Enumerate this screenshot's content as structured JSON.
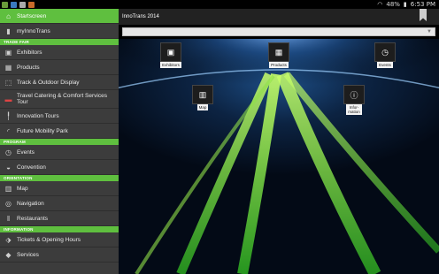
{
  "statusbar": {
    "battery": "48%",
    "time": "6:53 PM",
    "signal_icon": "wifi-icon"
  },
  "sidebar": {
    "startscreen": "Startscreen",
    "myinnotrans": "myInnoTrans",
    "sections": {
      "tradefair": "TRADE FAIR",
      "program": "PROGRAM",
      "orientation": "ORIENTATION",
      "information": "INFORMATION"
    },
    "tradefair_items": [
      "Exhibitors",
      "Products",
      "Track & Outdoor Display",
      "Travel Catering & Comfort Services Tour",
      "Innovation Tours",
      "Future Mobility Park"
    ],
    "program_items": [
      "Events",
      "Convention"
    ],
    "orientation_items": [
      "Map",
      "Navigation",
      "Restaurants"
    ],
    "information_items": [
      "Tickets & Opening Hours",
      "Services"
    ]
  },
  "header": {
    "title": "InnoTrans 2014"
  },
  "search": {
    "placeholder": "",
    "filter_icon": "filter-icon"
  },
  "tiles": {
    "exhibitors": "Exhibitors",
    "products": "Products",
    "events": "Events",
    "map": "Map",
    "information": "Infor-\nmation"
  },
  "colors": {
    "accent": "#5fbf3f",
    "sidebar": "#3c3c3c",
    "topbar": "#222222"
  }
}
